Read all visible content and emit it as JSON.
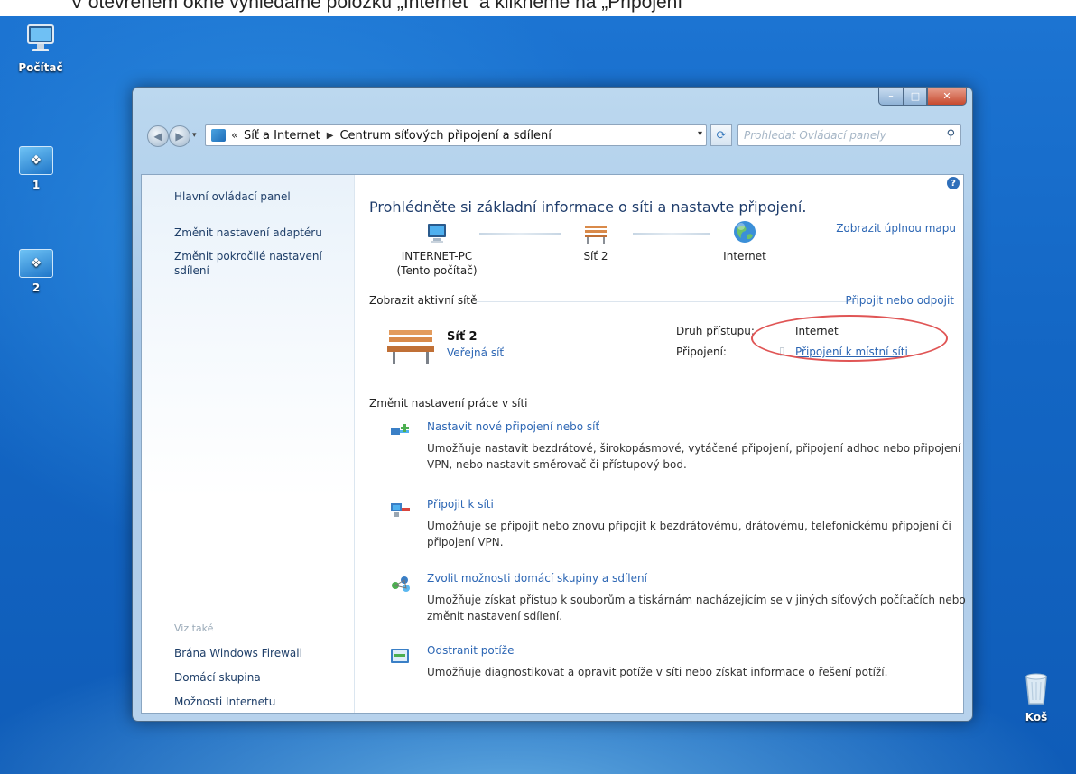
{
  "caption": "V otevřeném okně vyhledáme položku „Internet“ a klikneme na „Připojení“",
  "desktop": {
    "icons": [
      {
        "label": "Počítač"
      },
      {
        "label": "1"
      },
      {
        "label": "2"
      },
      {
        "label": "Koš"
      }
    ]
  },
  "window": {
    "caption_buttons": {
      "minimize": "–",
      "maximize": "□",
      "close": "✕"
    },
    "address": {
      "prefix": "«",
      "crumbs": [
        "Síť a Internet",
        "Centrum síťových připojení a sdílení"
      ]
    },
    "search": {
      "placeholder": "Prohledat Ovládací panely"
    },
    "sidebar": {
      "links": [
        "Hlavní ovládací panel",
        "Změnit nastavení adaptéru",
        "Změnit pokročilé nastavení sdílení"
      ],
      "see_also_label": "Viz také",
      "see_also": [
        "Brána Windows Firewall",
        "Domácí skupina",
        "Možnosti Internetu"
      ]
    },
    "main": {
      "title": "Prohlédněte si základní informace o síti a nastavte připojení.",
      "full_map_link": "Zobrazit úplnou mapu",
      "map": [
        {
          "name": "INTERNET-PC",
          "sub": "(Tento počítač)"
        },
        {
          "name": "Síť 2"
        },
        {
          "name": "Internet"
        }
      ],
      "active_networks_label": "Zobrazit aktivní sítě",
      "connect_link": "Připojit nebo odpojit",
      "network": {
        "name": "Síť 2",
        "type": "Veřejná síť",
        "access_label": "Druh přístupu:",
        "access_value": "Internet",
        "connection_label": "Připojení:",
        "connection_value": "Připojení k místní síti"
      },
      "change_settings_label": "Změnit nastavení práce v síti",
      "tasks": [
        {
          "title": "Nastavit nové připojení nebo síť",
          "desc": "Umožňuje nastavit bezdrátové, širokopásmové, vytáčené připojení, připojení adhoc nebo připojení VPN, nebo nastavit směrovač či přístupový bod."
        },
        {
          "title": "Připojit k síti",
          "desc": "Umožňuje se připojit nebo znovu připojit k bezdrátovému, drátovému, telefonickému připojení či připojení VPN."
        },
        {
          "title": "Zvolit možnosti domácí skupiny a sdílení",
          "desc": "Umožňuje získat přístup k souborům a tiskárnám nacházejícím se v jiných síťových počítačích nebo změnit nastavení sdílení."
        },
        {
          "title": "Odstranit potíže",
          "desc": "Umožňuje diagnostikovat a opravit potíže v síti nebo získat informace o řešení potíží."
        }
      ]
    }
  },
  "colors": {
    "link": "#2c66b4",
    "heading": "#1e3c6b",
    "annotation": "#e05555",
    "desktop": "#1366c4"
  }
}
